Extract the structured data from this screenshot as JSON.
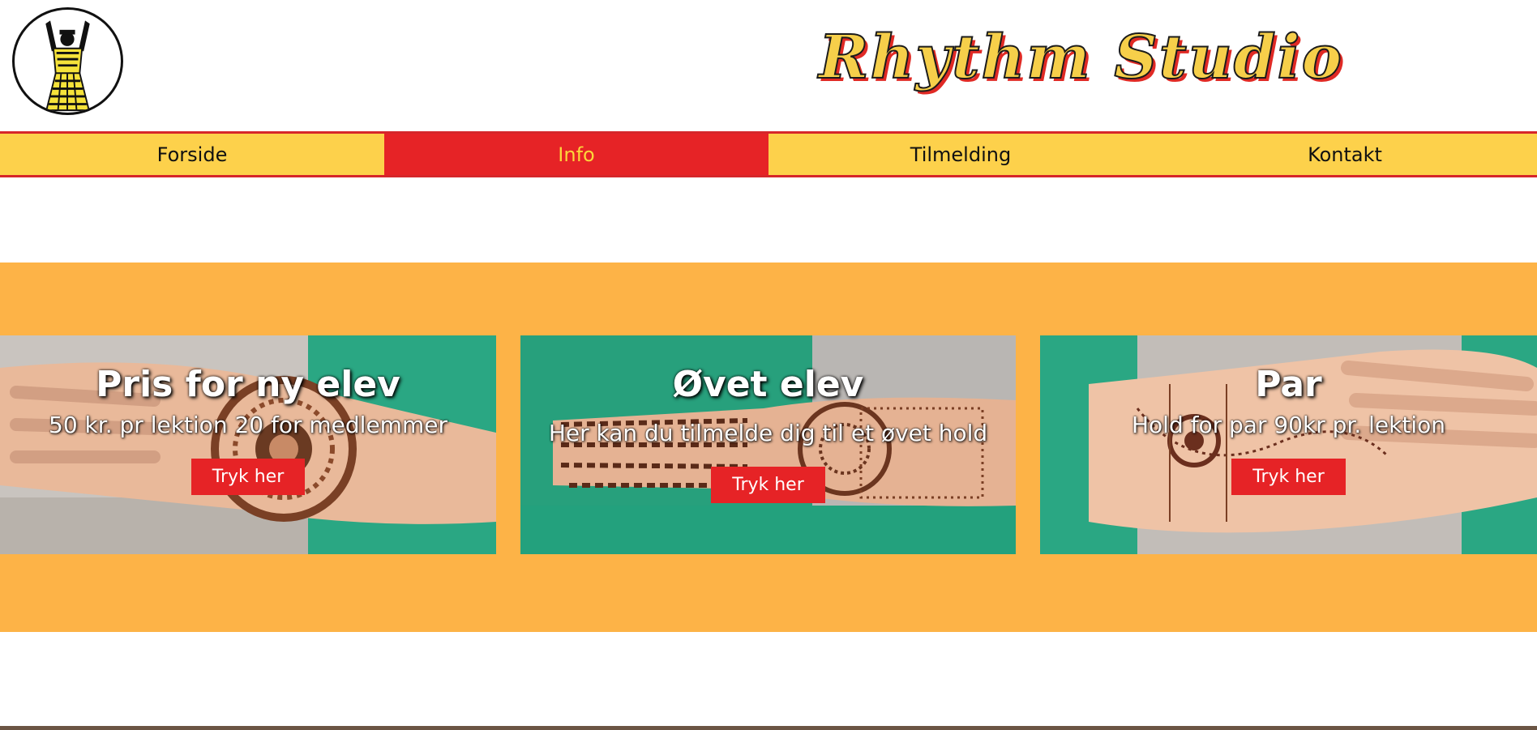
{
  "header": {
    "title": "Rhythm Studio",
    "logo_icon": "dancer-logo-icon"
  },
  "nav": {
    "items": [
      {
        "label": "Forside",
        "active": false
      },
      {
        "label": "Info",
        "active": true
      },
      {
        "label": "Tilmelding",
        "active": false
      },
      {
        "label": "Kontakt",
        "active": false
      }
    ]
  },
  "cards": [
    {
      "title": "Pris for ny elev",
      "text": "50 kr. pr lektion 20 for medlemmer",
      "button": "Tryk her"
    },
    {
      "title": "Øvet elev",
      "text": "Her kan du tilmelde dig til et øvet hold",
      "button": "Tryk her"
    },
    {
      "title": "Par",
      "text": "Hold for par 90kr pr. lektion",
      "button": "Tryk her"
    }
  ],
  "colors": {
    "nav_bg": "#fdd14b",
    "nav_active_bg": "#e62326",
    "nav_active_text": "#fcd63a",
    "nav_border": "#d6262a",
    "band": "#fdb347",
    "button": "#e62326",
    "title_fill": "#f6cf4a",
    "title_shadow": "#e02a25"
  }
}
